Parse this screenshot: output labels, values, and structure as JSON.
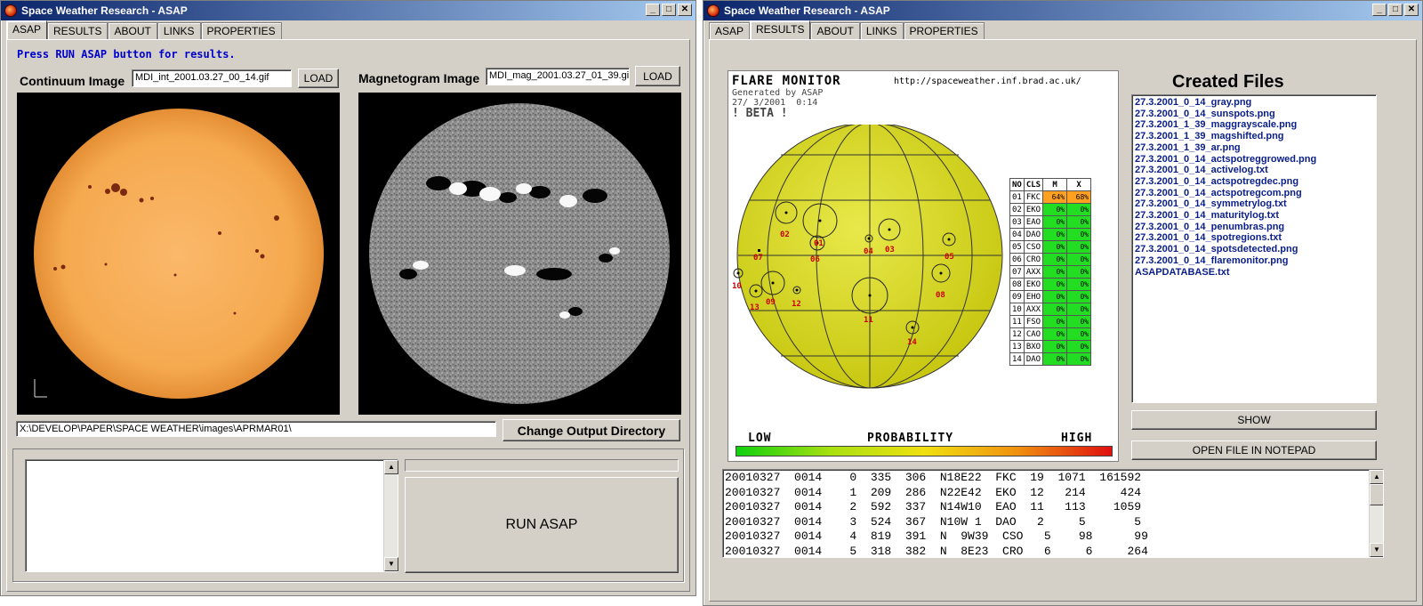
{
  "left": {
    "title": "Space Weather Research - ASAP",
    "tabs": [
      "ASAP",
      "RESULTS",
      "ABOUT",
      "LINKS",
      "PROPERTIES"
    ],
    "instruction": "Press RUN ASAP button for results.",
    "continuum_label": "Continuum Image",
    "continuum_file": "MDI_int_2001.03.27_00_14.gif",
    "magnetogram_label": "Magnetogram Image",
    "magnetogram_file": "MDI_mag_2001.03.27_01_39.gif",
    "load_label": "LOAD",
    "output_dir": "X:\\DEVELOP\\PAPER\\SPACE WEATHER\\images\\APRMAR01\\",
    "change_dir_label": "Change Output Directory",
    "run_label": "RUN ASAP"
  },
  "right": {
    "title": "Space Weather Research - ASAP",
    "tabs": [
      "ASAP",
      "RESULTS",
      "ABOUT",
      "LINKS",
      "PROPERTIES"
    ],
    "flare_monitor": {
      "title": "FLARE MONITOR",
      "url": "http://spaceweather.inf.brad.ac.uk/",
      "generated": "Generated by ASAP",
      "date": "27/ 3/2001  0:14",
      "beta": "! BETA !",
      "table_header": [
        "NO",
        "CLS",
        "M",
        "X"
      ],
      "rows": [
        {
          "no": "01",
          "cls": "FKC",
          "m": "64%",
          "x": "68%",
          "high": true
        },
        {
          "no": "02",
          "cls": "EKO",
          "m": "0%",
          "x": "0%",
          "high": false
        },
        {
          "no": "03",
          "cls": "EAO",
          "m": "0%",
          "x": "0%",
          "high": false
        },
        {
          "no": "04",
          "cls": "DAO",
          "m": "0%",
          "x": "0%",
          "high": false
        },
        {
          "no": "05",
          "cls": "CSO",
          "m": "0%",
          "x": "0%",
          "high": false
        },
        {
          "no": "06",
          "cls": "CRO",
          "m": "0%",
          "x": "0%",
          "high": false
        },
        {
          "no": "07",
          "cls": "AXX",
          "m": "0%",
          "x": "0%",
          "high": false
        },
        {
          "no": "08",
          "cls": "EKO",
          "m": "0%",
          "x": "0%",
          "high": false
        },
        {
          "no": "09",
          "cls": "EHO",
          "m": "0%",
          "x": "0%",
          "high": false
        },
        {
          "no": "10",
          "cls": "AXX",
          "m": "0%",
          "x": "0%",
          "high": false
        },
        {
          "no": "11",
          "cls": "FSO",
          "m": "0%",
          "x": "0%",
          "high": false
        },
        {
          "no": "12",
          "cls": "CAO",
          "m": "0%",
          "x": "0%",
          "high": false
        },
        {
          "no": "13",
          "cls": "BXO",
          "m": "0%",
          "x": "0%",
          "high": false
        },
        {
          "no": "14",
          "cls": "DAO",
          "m": "0%",
          "x": "0%",
          "high": false
        }
      ],
      "region_labels": [
        "01",
        "02",
        "03",
        "04",
        "05",
        "06",
        "07",
        "08",
        "09",
        "10",
        "11",
        "12",
        "13",
        "14"
      ],
      "scale_low": "LOW",
      "scale_mid": "PROBABILITY",
      "scale_high": "HIGH"
    },
    "created_files_title": "Created Files",
    "files": [
      "27.3.2001_0_14_gray.png",
      "27.3.2001_0_14_sunspots.png",
      "27.3.2001_1_39_maggrayscale.png",
      "27.3.2001_1_39_magshifted.png",
      "27.3.2001_1_39_ar.png",
      "27.3.2001_0_14_actspotreggrowed.png",
      "27.3.2001_0_14_activelog.txt",
      "27.3.2001_0_14_actspotregdec.png",
      "27.3.2001_0_14_actspotregcom.png",
      "27.3.2001_0_14_symmetrylog.txt",
      "27.3.2001_0_14_maturitylog.txt",
      "27.3.2001_0_14_penumbras.png",
      "27.3.2001_0_14_spotregions.txt",
      "27.3.2001_0_14_spotsdetected.png",
      "27.3.2001_0_14_flaremonitor.png",
      "ASAPDATABASE.txt"
    ],
    "show_label": "SHOW",
    "notepad_label": "OPEN FILE IN NOTEPAD",
    "log_lines": [
      "20010327  0014    0  335  306  N18E22  FKC  19  1071  161592",
      "20010327  0014    1  209  286  N22E42  EKO  12   214     424",
      "20010327  0014    2  592  337  N14W10  EAO  11   113    1059",
      "20010327  0014    3  524  367  N10W 1  DAO   2     5       5",
      "20010327  0014    4  819  391  N  9W39  CSO   5    98      99",
      "20010327  0014    5  318  382  N  8E23  CRO   6     6     264"
    ]
  },
  "colors": {
    "titlebar_start": "#0a246a",
    "titlebar_end": "#a6caf0",
    "window_bg": "#d4d0c8",
    "instruction_text": "#0000cc",
    "file_text": "#0a1e8a",
    "sun_continuum": "#f5a94f",
    "sun_flare": "#d4d41a"
  }
}
